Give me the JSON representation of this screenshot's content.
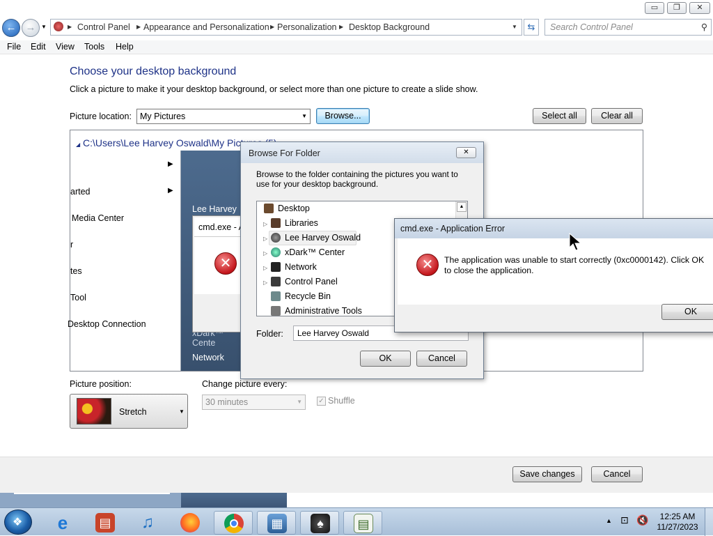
{
  "window": {
    "controls": {
      "minimize": "▭",
      "maximize": "❐",
      "close": "✕"
    }
  },
  "address_bar": {
    "back_icon": "←",
    "crumbs": [
      "Control Panel",
      "Appearance and Personalization",
      "Personalization",
      "Desktop Background"
    ],
    "search_placeholder": "Search Control Panel"
  },
  "menu": [
    "File",
    "Edit",
    "View",
    "Tools",
    "Help"
  ],
  "main": {
    "heading": "Choose your desktop background",
    "description": "Click a picture to make it your desktop background, or select more than one picture to create a slide show.",
    "picture_location_label": "Picture location:",
    "picture_location_value": "My Pictures",
    "browse_button": "Browse...",
    "select_all_button": "Select all",
    "clear_all_button": "Clear all",
    "path_text": "C:\\Users\\Lee Harvey Oswald\\My Pictures (5)",
    "picture_position_label": "Picture position:",
    "picture_position_value": "Stretch",
    "change_every_label": "Change picture every:",
    "change_every_value": "30 minutes",
    "shuffle_label": "Shuffle",
    "save_button": "Save changes",
    "cancel_button": "Cancel"
  },
  "start_menu": {
    "items": [
      "arted",
      "Media Center",
      "r",
      "tes",
      "Tool",
      "Desktop Connection"
    ],
    "right_items": [
      "Lee Harvey O",
      "xDark™ Cente",
      "Network"
    ]
  },
  "ghost_dialog": {
    "title": "cmd.exe - A"
  },
  "browse_dialog": {
    "title": "Browse For Folder",
    "instructions": "Browse to the folder containing the pictures you want to use for your desktop background.",
    "tree": [
      "Desktop",
      "Libraries",
      "Lee Harvey Oswald",
      "xDark™ Center",
      "Network",
      "Control Panel",
      "Recycle Bin",
      "Administrative Tools"
    ],
    "folder_label": "Folder:",
    "folder_value": "Lee Harvey Oswald",
    "ok_button": "OK",
    "cancel_button": "Cancel"
  },
  "error_dialog": {
    "title": "cmd.exe - Application Error",
    "message": "The application was unable to start correctly (0xc0000142). Click OK to close the application.",
    "ok_button": "OK"
  },
  "taskbar": {
    "clock_time": "12:25 AM",
    "clock_date": "11/27/2023"
  },
  "colors": {
    "heading": "#1e3287",
    "error_red": "#c4161c",
    "taskbar": "#a8bfd8"
  }
}
